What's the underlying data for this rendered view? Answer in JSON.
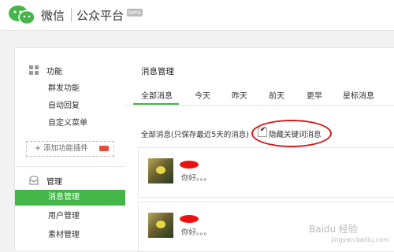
{
  "header": {
    "brand": "微信",
    "platform": "公众平台",
    "beta": "beta"
  },
  "sidebar": {
    "sections": [
      {
        "title": "功能",
        "icon": "grid-icon"
      },
      {
        "title": "管理",
        "icon": "inbox-icon"
      }
    ],
    "function_items": [
      "群发功能",
      "自动回复",
      "自定义菜单"
    ],
    "add_plugin": "添加功能插件",
    "manage_items": [
      "消息管理",
      "用户管理",
      "素材管理"
    ],
    "active_item": "消息管理"
  },
  "main": {
    "title": "消息管理",
    "tabs": [
      "全部消息",
      "今天",
      "昨天",
      "前天",
      "更早",
      "星标消息"
    ],
    "active_tab": "全部消息",
    "filter_label": "全部消息(只保存最近5天的消息)",
    "checkbox_label": "隐藏关键词消息",
    "checkbox_checked": true,
    "messages": [
      {
        "text": "你好。。。"
      },
      {
        "text": "你好。。。"
      }
    ]
  },
  "watermark": {
    "text": "Baidu 经验",
    "sub": "jingyan.baidu.com"
  },
  "colors": {
    "accent": "#44b549",
    "highlight": "#d31919"
  }
}
